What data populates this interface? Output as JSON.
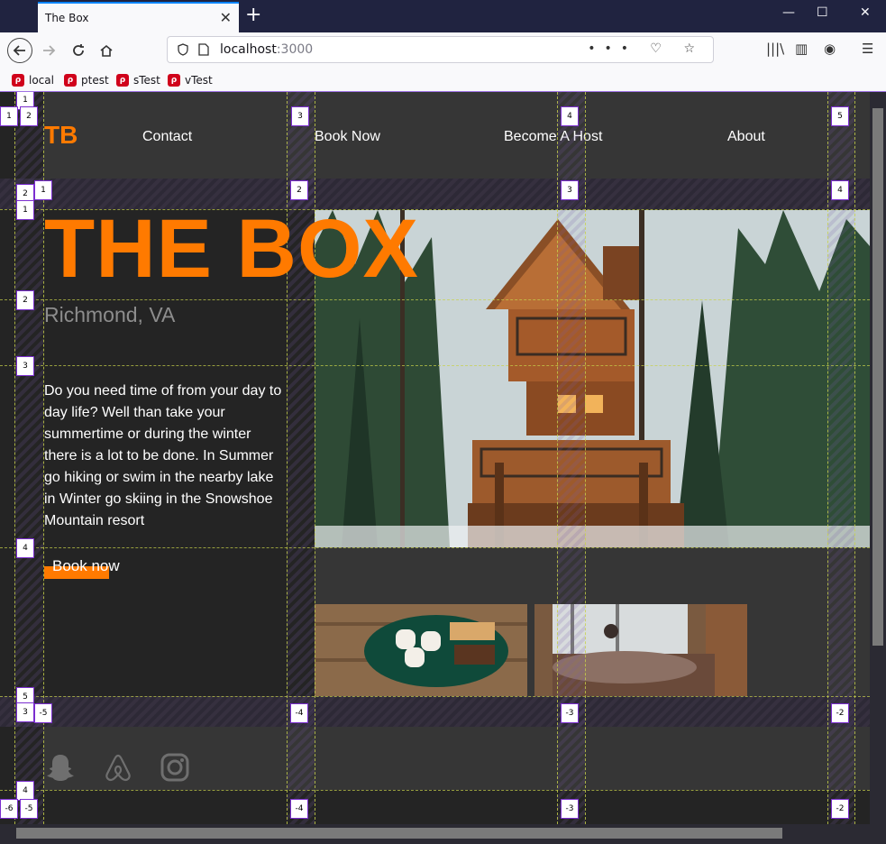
{
  "browser": {
    "tab_title": "The Box",
    "close_tab": "✕",
    "new_tab": "+",
    "url_host": "localhost",
    "url_port": ":3000",
    "window_controls": [
      "—",
      "☐",
      "✕"
    ],
    "bookmarks": [
      {
        "label": "local"
      },
      {
        "label": "ptest"
      },
      {
        "label": "sTest"
      },
      {
        "label": "vTest"
      }
    ]
  },
  "site": {
    "logo": "TB",
    "nav": [
      "Contact",
      "Book Now",
      "Become A Host",
      "About"
    ],
    "hero_title": "THE BOX",
    "location": "Richmond, VA",
    "description": "Do you need time of from your day to day life? Well than take your summertime or during the winter there is a lot to be done. In Summer go hiking or swim in the nearby lake in Winter go skiing in the Snowshoe Mountain resort",
    "cta": "Book now",
    "social": [
      "snapchat-icon",
      "airbnb-icon",
      "instagram-icon"
    ]
  },
  "grid_overlay": {
    "top_labels": [
      "1",
      "2",
      "3",
      "4",
      "5"
    ],
    "row_labels": [
      "1",
      "2",
      "3",
      "4",
      "5"
    ],
    "bottom_labels": [
      "-5",
      "-4",
      "-3",
      "-2"
    ],
    "footer_labels": [
      "-6",
      "-5",
      "-4",
      "-3",
      "-2"
    ],
    "side_labels": [
      "1",
      "2",
      "3",
      "4"
    ]
  },
  "colors": {
    "accent": "#ff7a00",
    "page_bg": "#242424",
    "panel_bg": "#363636",
    "grid_line": "#c8d24a"
  }
}
